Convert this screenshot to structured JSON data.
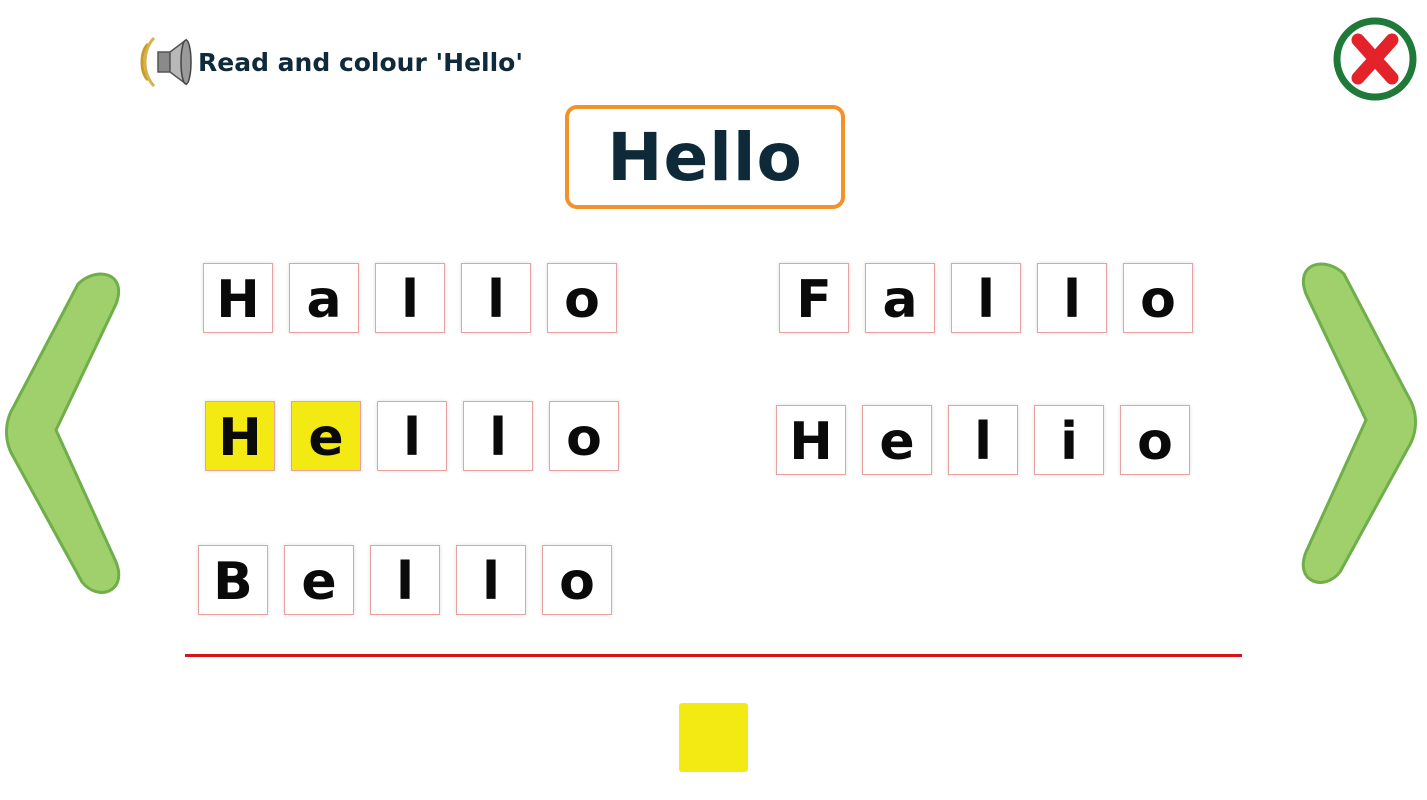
{
  "instruction": {
    "text": "Read and colour 'Hello'",
    "speaker_icon": "speaker-icon"
  },
  "target_word": "Hello",
  "close_icon": "close-icon",
  "nav": {
    "prev_icon": "chevron-left-icon",
    "next_icon": "chevron-right-icon",
    "arrow_color": "#9fd06b",
    "arrow_outline": "#6fae4a"
  },
  "words": [
    {
      "letters": [
        "H",
        "a",
        "l",
        "l",
        "o"
      ],
      "colored": [
        false,
        false,
        false,
        false,
        false
      ]
    },
    {
      "letters": [
        "F",
        "a",
        "l",
        "l",
        "o"
      ],
      "colored": [
        false,
        false,
        false,
        false,
        false
      ]
    },
    {
      "letters": [
        "H",
        "e",
        "l",
        "l",
        "o"
      ],
      "colored": [
        true,
        true,
        false,
        false,
        false
      ]
    },
    {
      "letters": [
        "H",
        "e",
        "l",
        "i",
        "o"
      ],
      "colored": [
        false,
        false,
        false,
        false,
        false
      ]
    },
    {
      "letters": [
        "B",
        "e",
        "l",
        "l",
        "o"
      ],
      "colored": [
        false,
        false,
        false,
        false,
        false
      ]
    }
  ],
  "colors": {
    "highlight": "#f4ea13",
    "divider": "#d3141e",
    "target_border": "#f1922a",
    "close_ring": "#1f7a3a",
    "close_x": "#e3222a"
  },
  "palette": {
    "selected_color": "#f4ea13"
  }
}
